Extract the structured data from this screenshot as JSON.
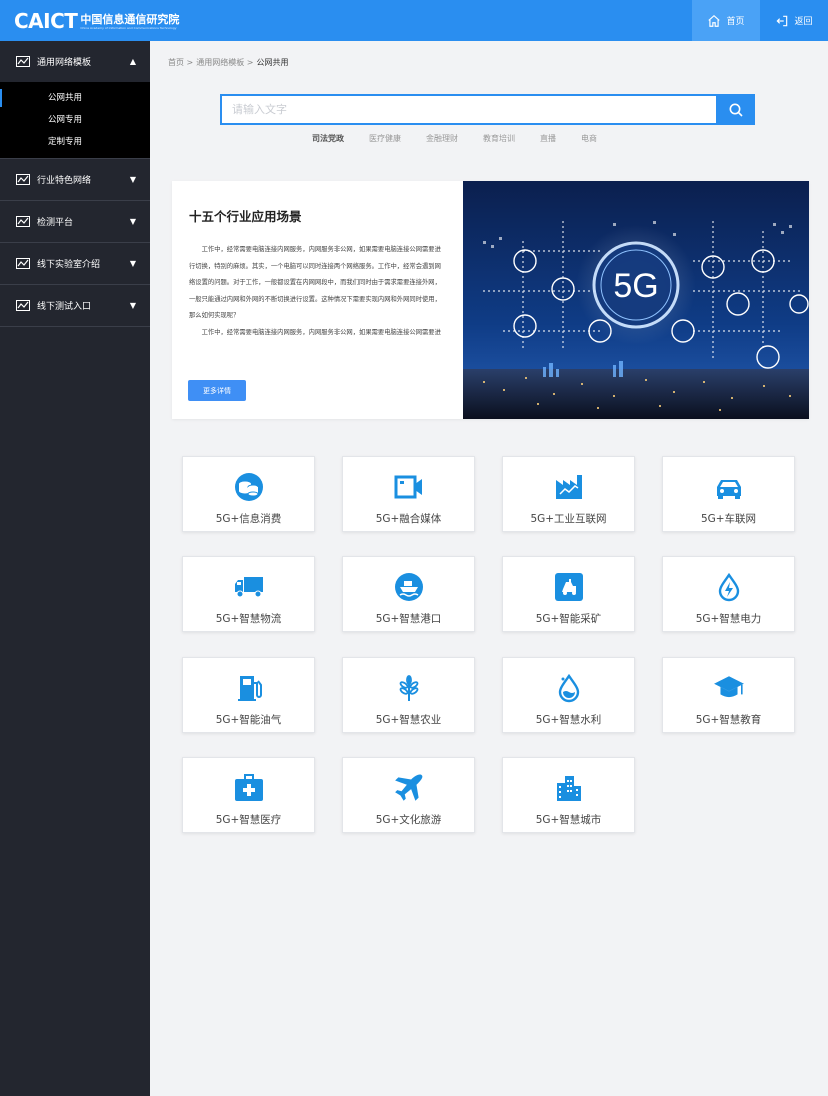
{
  "header": {
    "logo_mark": "CAICT",
    "logo_cn": "中国信息通信研究院",
    "logo_en": "China Academy of Information and Communications Technology",
    "nav": [
      {
        "label": "首页",
        "icon": "home-icon"
      },
      {
        "label": "返回",
        "icon": "exit-icon"
      }
    ]
  },
  "sidebar": {
    "groups": [
      {
        "label": "通用网络模板",
        "arrow": "▲",
        "sub": [
          "公网共用",
          "公网专用",
          "定制专用"
        ]
      },
      {
        "label": "行业特色网络",
        "arrow": "▼"
      },
      {
        "label": "检测平台",
        "arrow": "▼"
      },
      {
        "label": "线下实验室介绍",
        "arrow": "▼"
      },
      {
        "label": "线下测试入口",
        "arrow": "▼"
      }
    ]
  },
  "breadcrumb": {
    "home": "首页 >",
    "parent": "通用网络模板 >",
    "current": "公网共用"
  },
  "search": {
    "placeholder": "请输入文字"
  },
  "hot_tags": [
    "司法党政",
    "医疗健康",
    "金融理财",
    "教育培训",
    "直播",
    "电商"
  ],
  "feature": {
    "title": "十五个行业应用场景",
    "para1": "工作中，经常需要电脑连接内网服务，内网服务非公网，如果需要电脑连接公网需要进行切换，特别的麻烦。其实，一个电脑可以同时连接两个网络服务。工作中，经常会遇到网络设置的问题。对于工作，一般都设置在内网网段中，而我们同时由于需求需要连接外网，一般只能通过内网和外网的不断切换进行设置。这种情况下需要实现内网和外网同时使用，那么如何实现呢？",
    "para2": "工作中，经常需要电脑连接内网服务，内网服务非公网，如果需要电脑连接公网需要进行切换，特别的麻烦。脑连接公网需要进行切换，特别",
    "button": "更多详情",
    "image_text": "5G"
  },
  "cards": [
    {
      "label": "5G+信息消费",
      "icon": "coins-icon"
    },
    {
      "label": "5G+融合媒体",
      "icon": "video-camera-icon"
    },
    {
      "label": "5G+工业互联网",
      "icon": "factory-icon"
    },
    {
      "label": "5G+车联网",
      "icon": "car-icon"
    },
    {
      "label": "5G+智慧物流",
      "icon": "truck-icon"
    },
    {
      "label": "5G+智慧港口",
      "icon": "ship-icon"
    },
    {
      "label": "5G+智能采矿",
      "icon": "mining-icon"
    },
    {
      "label": "5G+智慧电力",
      "icon": "power-drop-icon"
    },
    {
      "label": "5G+智能油气",
      "icon": "fuel-pump-icon"
    },
    {
      "label": "5G+智慧农业",
      "icon": "wheat-icon"
    },
    {
      "label": "5G+智慧水利",
      "icon": "water-drop-icon"
    },
    {
      "label": "5G+智慧教育",
      "icon": "graduation-cap-icon"
    },
    {
      "label": "5G+智慧医疗",
      "icon": "medical-kit-icon"
    },
    {
      "label": "5G+文化旅游",
      "icon": "airplane-icon"
    },
    {
      "label": "5G+智慧城市",
      "icon": "city-buildings-icon"
    }
  ],
  "colors": {
    "brand": "#2a8ef0",
    "sidebar": "#23262f",
    "icon": "#1a8fe0"
  }
}
